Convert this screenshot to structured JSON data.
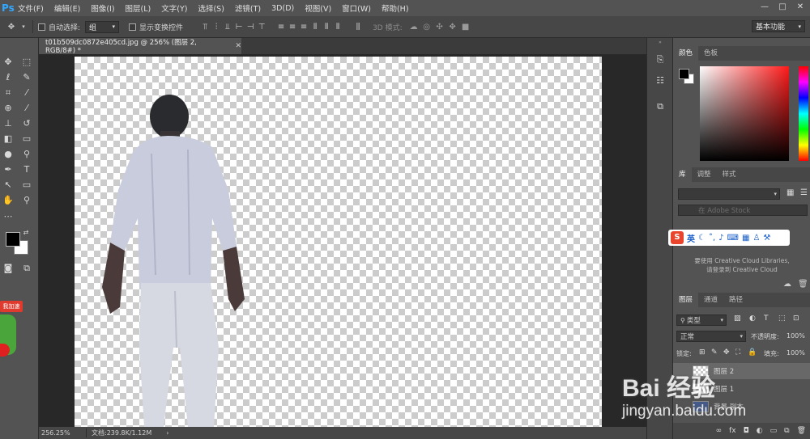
{
  "app": {
    "logo": "Ps",
    "menu": [
      "文件(F)",
      "编辑(E)",
      "图像(I)",
      "图层(L)",
      "文字(Y)",
      "选择(S)",
      "滤镜(T)",
      "3D(D)",
      "视图(V)",
      "窗口(W)",
      "帮助(H)"
    ],
    "window_buttons": [
      "—",
      "□",
      "✕"
    ]
  },
  "options_bar": {
    "auto_select_label": "自动选择:",
    "auto_select_value": "组",
    "show_transform_label": "显示变换控件",
    "mode_3d_label": "3D 模式:",
    "workspace": "基本功能"
  },
  "document": {
    "tab_title": "t01b509dc0872e405cd.jpg @ 256% (图层 2, RGB/8#) *",
    "zoom": "256.25%",
    "doc_size": "文档:239.8K/1.12M"
  },
  "panels": {
    "color_tabs": [
      "颜色",
      "色板"
    ],
    "library_tabs": [
      "库",
      "调整",
      "样式"
    ],
    "search_placeholder": "在 Adobe Stock",
    "ime_label": "英",
    "library_msg_line1": "要使用 Creative Cloud Libraries,",
    "library_msg_line2": "请登录到 Creative Cloud",
    "layers_tabs": [
      "图层",
      "通道",
      "路径"
    ],
    "kind_filter": "类型",
    "blend_mode": "正常",
    "opacity_label": "不透明度:",
    "opacity_value": "100%",
    "lock_label": "锁定:",
    "fill_label": "填充:",
    "fill_value": "100%",
    "layers": [
      "图层 2",
      "图层 1",
      "背景 副本"
    ]
  },
  "watermark": {
    "line1": "Bai 经验",
    "line2": "jingyan.baidu.com"
  },
  "badge_text": "我加速",
  "colors": {
    "accent": "#31a8ff",
    "panel": "#535353",
    "dark": "#282828",
    "foreground_swatch": "#000000",
    "background_swatch": "#ffffff"
  }
}
